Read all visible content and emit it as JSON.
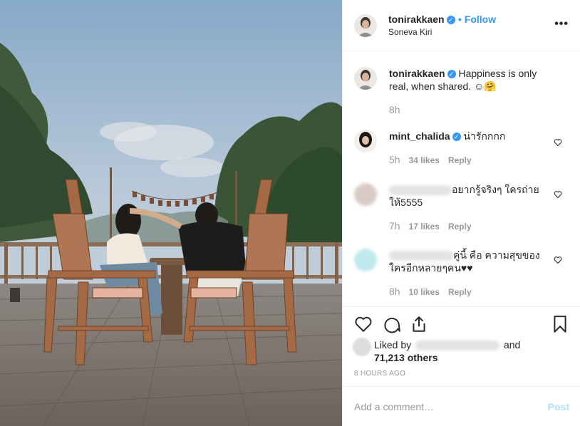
{
  "post": {
    "username": "tonirakkaen",
    "follow_label": "Follow",
    "location": "Soneva Kiri"
  },
  "icons": {
    "more": "more-options-icon",
    "verified": "verified-badge-icon",
    "like": "heart-icon",
    "comment": "comment-bubble-icon",
    "share": "share-icon",
    "save": "bookmark-icon"
  },
  "caption": {
    "username": "tonirakkaen",
    "text": "Happiness is only real, when shared. ☺🤗",
    "time": "8h"
  },
  "comments": [
    {
      "username": "mint_chalida",
      "text": "น่ารักกกก",
      "time": "5h",
      "likes": "34 likes",
      "reply": "Reply"
    },
    {
      "username": "",
      "text": "อยากรู้จริงๆ ใครถ่ายให้5555",
      "time": "7h",
      "likes": "17 likes",
      "reply": "Reply"
    },
    {
      "username": "",
      "text": "คู่นี้ คือ ความสุขของใครอีกหลายๆคน♥♥",
      "time": "8h",
      "likes": "10 likes",
      "reply": "Reply"
    }
  ],
  "likes": {
    "prefix": "Liked by",
    "suffix": "and",
    "others": "71,213 others"
  },
  "timeago": "8 HOURS AGO",
  "add_comment": {
    "placeholder": "Add a comment…",
    "post_label": "Post"
  },
  "colors": {
    "accent": "#3897f0",
    "post_disabled": "#b2dffc",
    "muted": "#999999"
  }
}
